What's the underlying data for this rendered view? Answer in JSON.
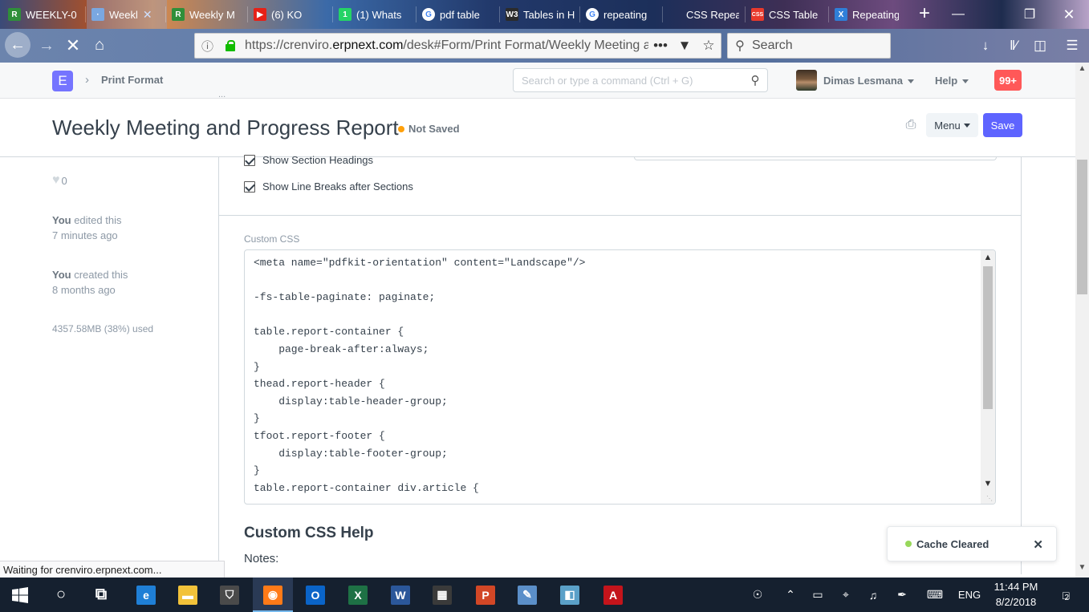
{
  "browser": {
    "tabs": [
      {
        "title": "WEEKLY-0",
        "icon": "erpnext-r-icon",
        "color": "#2f8f3a",
        "glyph": "R"
      },
      {
        "title": "Weekl",
        "icon": "loading-icon",
        "color": "#7aa7e0",
        "glyph": "·",
        "active": true
      },
      {
        "title": "Weekly M",
        "icon": "erpnext-r-icon",
        "color": "#2f8f3a",
        "glyph": "R"
      },
      {
        "title": "(6) KO",
        "icon": "youtube-icon",
        "color": "#e62117",
        "glyph": "▶"
      },
      {
        "title": "(1) Whats",
        "icon": "whatsapp-icon",
        "color": "#25d366",
        "glyph": "1"
      },
      {
        "title": "pdf table",
        "icon": "google-icon",
        "color": "#ffffff",
        "glyph": "G"
      },
      {
        "title": "Tables in H",
        "icon": "w3schools-icon",
        "color": "#2b2b2b",
        "glyph": "W3"
      },
      {
        "title": "repeating",
        "icon": "google-icon",
        "color": "#ffffff",
        "glyph": "G"
      },
      {
        "title": "CSS Repeated",
        "icon": "blank-icon",
        "color": "transparent",
        "glyph": ""
      },
      {
        "title": "CSS Table",
        "icon": "css-icon",
        "color": "#e8392c",
        "glyph": "CSS"
      },
      {
        "title": "Repeating",
        "icon": "x-icon",
        "color": "#2f7fd8",
        "glyph": "X"
      }
    ],
    "url_prefix": "https://crenviro.",
    "url_domain": "erpnext.com",
    "url_path": "/desk#Form/Print Format/Weekly Meeting an",
    "search_placeholder": "Search",
    "status_text": "Waiting for crenviro.erpnext.com..."
  },
  "navbar": {
    "logo": "E",
    "breadcrumb": "Print Format",
    "search_placeholder": "Search or type a command (Ctrl + G)",
    "user": "Dimas Lesmana",
    "help": "Help",
    "notifications": "99+"
  },
  "page": {
    "peek_text": "...",
    "title": "Weekly Meeting and Progress Report",
    "status": "Not Saved",
    "menu_label": "Menu",
    "save_label": "Save"
  },
  "sidebar": {
    "likes": "0",
    "edited_by": "You",
    "edited_action": " edited this",
    "edited_time": "7 minutes ago",
    "created_by": "You",
    "created_action": " created this",
    "created_time": "8 months ago",
    "quota": "4357.58MB (38%) used"
  },
  "form": {
    "checkboxes": [
      {
        "label": "Show Section Headings",
        "checked": true
      },
      {
        "label": "Show Line Breaks after Sections",
        "checked": true
      }
    ],
    "css_label": "Custom CSS",
    "css_lines": [
      "<meta name=\"pdfkit-orientation\" content=\"Landscape\"/>",
      "",
      "-fs-table-paginate: paginate;",
      "",
      "table.report-container {",
      "    page-break-after:always;",
      "}",
      "thead.report-header {",
      "    display:table-header-group;",
      "}",
      "tfoot.report-footer {",
      "    display:table-footer-group;",
      "}",
      "table.report-container div.article {"
    ],
    "help_title": "Custom CSS Help",
    "notes_label": "Notes:"
  },
  "toast": {
    "message": "Cache Cleared"
  },
  "taskbar": {
    "apps": [
      {
        "name": "cortana",
        "glyph": "○",
        "color": "transparent"
      },
      {
        "name": "task-view",
        "glyph": "⧉",
        "color": "transparent"
      },
      {
        "name": "edge",
        "glyph": "e",
        "color": "#1f7fd6"
      },
      {
        "name": "file-explorer",
        "glyph": "▬",
        "color": "#f2c23a"
      },
      {
        "name": "store",
        "glyph": "⛉",
        "color": "#4a4a4a"
      },
      {
        "name": "firefox",
        "glyph": "◉",
        "color": "#ff7a18",
        "active": true
      },
      {
        "name": "outlook",
        "glyph": "O",
        "color": "#0a64c8"
      },
      {
        "name": "excel",
        "glyph": "X",
        "color": "#1e7145"
      },
      {
        "name": "word",
        "glyph": "W",
        "color": "#2b579a"
      },
      {
        "name": "calculator",
        "glyph": "▦",
        "color": "#3a3a3a"
      },
      {
        "name": "powerpoint",
        "glyph": "P",
        "color": "#d24726"
      },
      {
        "name": "paint",
        "glyph": "✎",
        "color": "#5b8fc9"
      },
      {
        "name": "notes",
        "glyph": "◧",
        "color": "#5aa0c8"
      },
      {
        "name": "acrobat",
        "glyph": "A",
        "color": "#c4141b"
      }
    ],
    "language": "ENG",
    "time": "11:44 PM",
    "date": "8/2/2018",
    "action_center_count": "2"
  }
}
